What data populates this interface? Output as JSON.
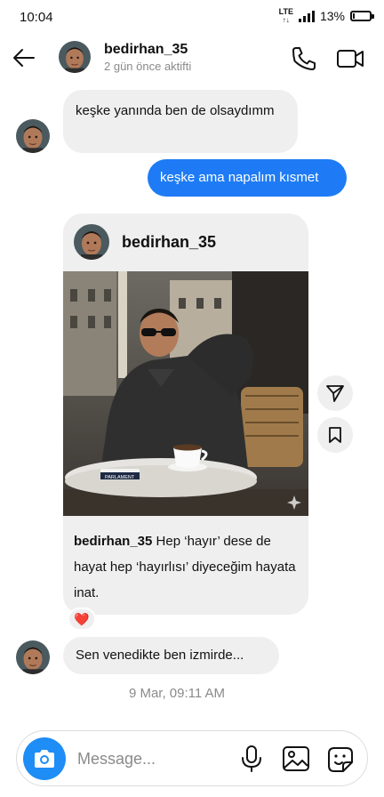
{
  "status_bar": {
    "time": "10:04",
    "network_top": "LTE",
    "network_bottom": "↑↓",
    "battery_text": "13%",
    "battery_level": 0.13
  },
  "header": {
    "username": "bedirhan_35",
    "active_status": "2 gün önce aktifti"
  },
  "messages": [
    {
      "direction": "incoming",
      "text": "keşke yanında ben de olsaydımm"
    },
    {
      "direction": "outgoing",
      "text": "keşke ama napalım kısmet"
    }
  ],
  "shared_post": {
    "author": "bedirhan_35",
    "caption_author": "bedirhan_35",
    "caption_text": "Hep ‘hayır’ dese de hayat hep ‘hayırlısı’ diyeceğim hayata inat.",
    "reaction": "❤️",
    "image_text": "PARLAMENT"
  },
  "last_message": {
    "direction": "incoming",
    "text": "Sen venedikte ben izmirde..."
  },
  "timestamp": "9 Mar, 09:11 AM",
  "composer": {
    "placeholder": "Message..."
  },
  "colors": {
    "outgoing_bubble": "#1e7bf5",
    "incoming_bubble": "#efefef",
    "camera_button": "#1e8df5",
    "heart": "#e0245e"
  },
  "icons": [
    "back-arrow-icon",
    "phone-icon",
    "video-camera-icon",
    "send-icon",
    "bookmark-icon",
    "camera-icon",
    "microphone-icon",
    "gallery-icon",
    "sticker-icon",
    "sparkle-icon"
  ]
}
